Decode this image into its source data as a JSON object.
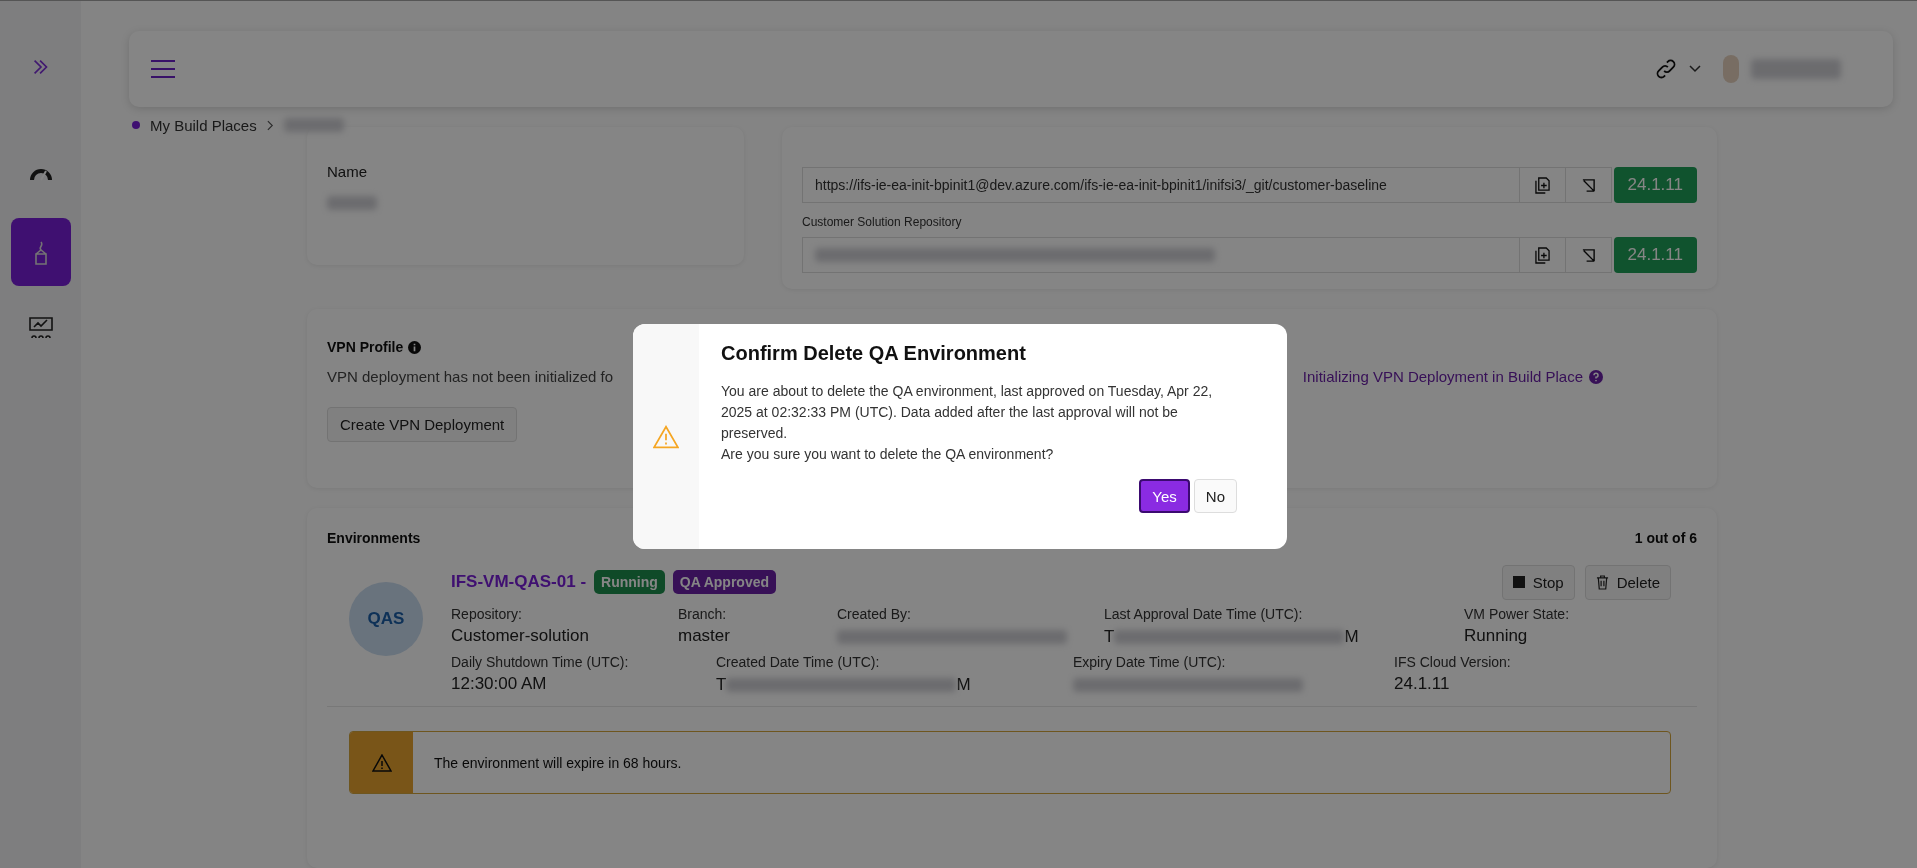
{
  "breadcrumb": {
    "items": [
      "My Build Places"
    ]
  },
  "name_card": {
    "label": "Name"
  },
  "repositories": [
    {
      "url": "https://ifs-ie-ea-init-bpinit1@dev.azure.com/ifs-ie-ea-init-bpinit1/inifsi3/_git/customer-baseline",
      "version": "24.1.11"
    },
    {
      "label": "Customer Solution Repository",
      "version": "24.1.11"
    }
  ],
  "vpn": {
    "title": "VPN Profile",
    "message": "VPN deployment has not been initialized fo",
    "link": "Initializing VPN Deployment in Build Place",
    "button": "Create VPN Deployment"
  },
  "environments": {
    "title": "Environments",
    "count": "1 out of 6",
    "environment": {
      "avatar": "QAS",
      "name": "IFS-VM-QAS-01 -",
      "badges": [
        {
          "label": "Running",
          "kind": "status"
        },
        {
          "label": "QA Approved",
          "kind": "approval"
        }
      ],
      "actions": [
        {
          "kind": "stop",
          "label": "Stop"
        },
        {
          "kind": "delete",
          "label": "Delete"
        }
      ],
      "field_rows": [
        [
          {
            "label": "Repository:",
            "value": "Customer-solution"
          },
          {
            "label": "Branch:",
            "value": "master"
          },
          {
            "label": "Created By:"
          },
          {
            "label": "Last Approval Date Time (UTC):",
            "prefix": "T",
            "suffix": "M"
          },
          {
            "label": "VM Power State:",
            "value": "Running"
          }
        ],
        [
          {
            "label": "Daily Shutdown Time (UTC):",
            "value": "12:30:00 AM"
          },
          {
            "label": "Created Date Time (UTC):",
            "prefix": "T",
            "suffix": "M"
          },
          {
            "label": "Expiry Date Time (UTC):"
          },
          {
            "label": "IFS Cloud Version:",
            "value": "24.1.11"
          }
        ]
      ],
      "warning": "The environment will expire in 68 hours."
    }
  },
  "dialog": {
    "title": "Confirm Delete QA Environment",
    "lines": [
      "You are about to delete the QA environment, last approved on Tuesday, Apr 22, 2025 at 02:32:33 PM (UTC). Data added after the last approval will not be preserved.",
      "Are you sure you want to delete the QA environment?"
    ],
    "buttons": [
      {
        "label": "Yes",
        "kind": "primary"
      },
      {
        "label": "No",
        "kind": "secondary"
      }
    ]
  }
}
